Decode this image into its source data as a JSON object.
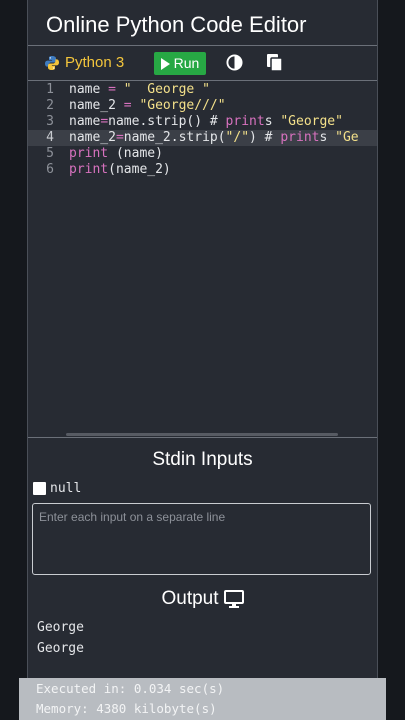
{
  "app": {
    "title": "Online Python Code Editor"
  },
  "toolbar": {
    "language_label": "Python 3",
    "language_icon": "python-logo-icon",
    "run_label": "Run",
    "theme_icon": "contrast-icon",
    "copy_icon": "copy-icon"
  },
  "editor": {
    "lines": [
      {
        "num": "1",
        "text": "name = \"  George \""
      },
      {
        "num": "2",
        "text": "name_2 = \"George///\""
      },
      {
        "num": "3",
        "text": "name=name.strip() # prints \"George\""
      },
      {
        "num": "4",
        "text": "name_2=name_2.strip(\"/\") # prints \"Ge"
      },
      {
        "num": "5",
        "text": "print (name)"
      },
      {
        "num": "6",
        "text": "print(name_2)"
      }
    ],
    "active_line": 4
  },
  "stdin": {
    "title": "Stdin Inputs",
    "null_label": "null",
    "placeholder": "Enter each input on a separate line",
    "value": ""
  },
  "output": {
    "title": "Output",
    "icon": "monitor-icon",
    "lines": [
      "George",
      "George"
    ]
  },
  "stats": {
    "executed": "Executed in: 0.034 sec(s)",
    "memory": "Memory: 4380 kilobyte(s)"
  },
  "colors": {
    "background": "#272b33",
    "run_button": "#27a844",
    "language_text": "#f3c53c",
    "string": "#f3e08a",
    "keyword": "#d872bf"
  }
}
